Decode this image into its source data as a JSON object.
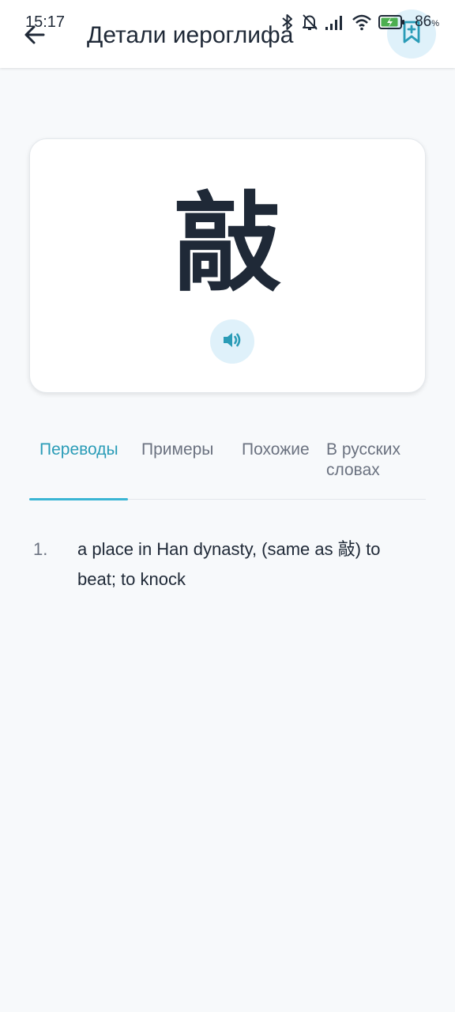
{
  "status_bar": {
    "time": "15:17",
    "battery_percent": "86",
    "battery_percent_symbol": "%"
  },
  "app_bar": {
    "title": "Детали иероглифа",
    "back_icon": "arrow-left-icon",
    "bookmark_icon": "bookmark-add-icon"
  },
  "character_card": {
    "character": "敲",
    "speaker_icon": "volume-icon"
  },
  "tabs": [
    {
      "label": "Переводы",
      "active": true
    },
    {
      "label": "Примеры",
      "active": false
    },
    {
      "label": "Похожие",
      "active": false
    },
    {
      "label": "В русских",
      "label_line2": "словах",
      "active": false
    }
  ],
  "translations": [
    {
      "number": "1.",
      "text": "a place in Han dynasty, (same as 敲) to beat; to knock"
    }
  ],
  "colors": {
    "accent": "#2a9cb7",
    "accent_indicator": "#3ab5d4",
    "button_bg": "#dff1fa",
    "background": "#f7f9fb"
  }
}
